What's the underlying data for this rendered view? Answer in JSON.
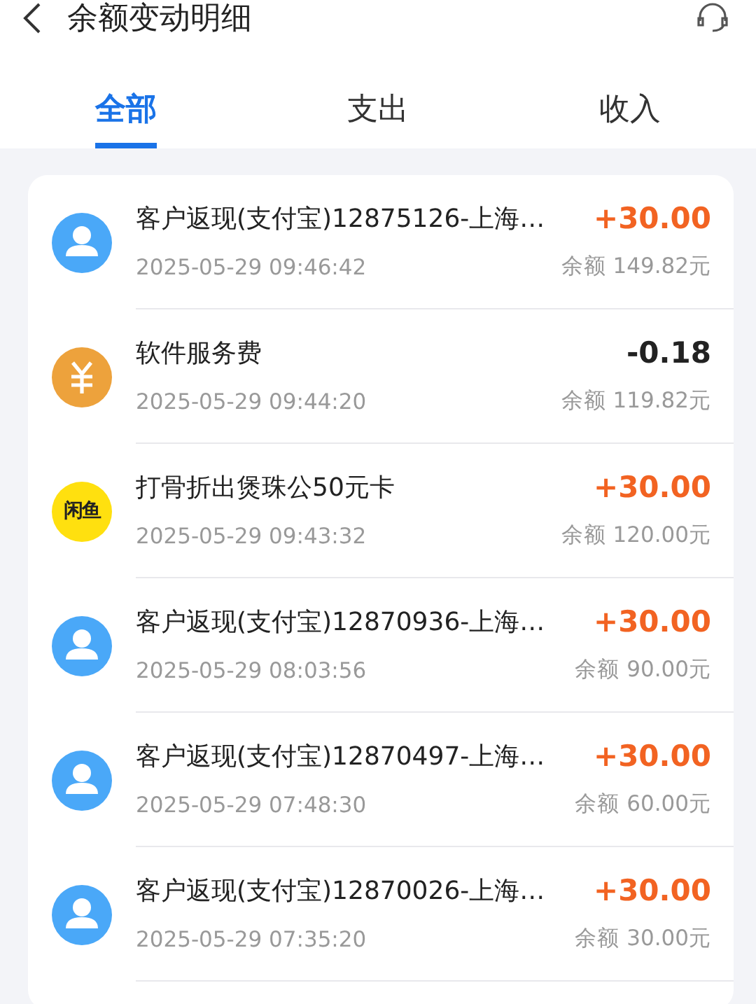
{
  "header": {
    "title": "余额变动明细"
  },
  "tabs": [
    {
      "label": "全部",
      "selected": true
    },
    {
      "label": "支出",
      "selected": false
    },
    {
      "label": "收入",
      "selected": false
    }
  ],
  "transactions": [
    {
      "kind": "avatar",
      "title": "客户返现(支付宝)12875126-上海…",
      "amount": "+30.00",
      "income": true,
      "time": "2025-05-29 09:46:42",
      "balance": "余额 149.82元"
    },
    {
      "kind": "yuan",
      "title": "软件服务费",
      "amount": "-0.18",
      "income": false,
      "time": "2025-05-29 09:44:20",
      "balance": "余额 119.82元"
    },
    {
      "kind": "logo",
      "logo_text": "闲鱼",
      "title": "打骨折出煲珠公50元卡",
      "amount": "+30.00",
      "income": true,
      "time": "2025-05-29 09:43:32",
      "balance": "余额 120.00元"
    },
    {
      "kind": "avatar",
      "title": "客户返现(支付宝)12870936-上海…",
      "amount": "+30.00",
      "income": true,
      "time": "2025-05-29 08:03:56",
      "balance": "余额 90.00元"
    },
    {
      "kind": "avatar",
      "title": "客户返现(支付宝)12870497-上海…",
      "amount": "+30.00",
      "income": true,
      "time": "2025-05-29 07:48:30",
      "balance": "余额 60.00元"
    },
    {
      "kind": "avatar",
      "title": "客户返现(支付宝)12870026-上海…",
      "amount": "+30.00",
      "income": true,
      "time": "2025-05-29 07:35:20",
      "balance": "余额 30.00元"
    }
  ]
}
